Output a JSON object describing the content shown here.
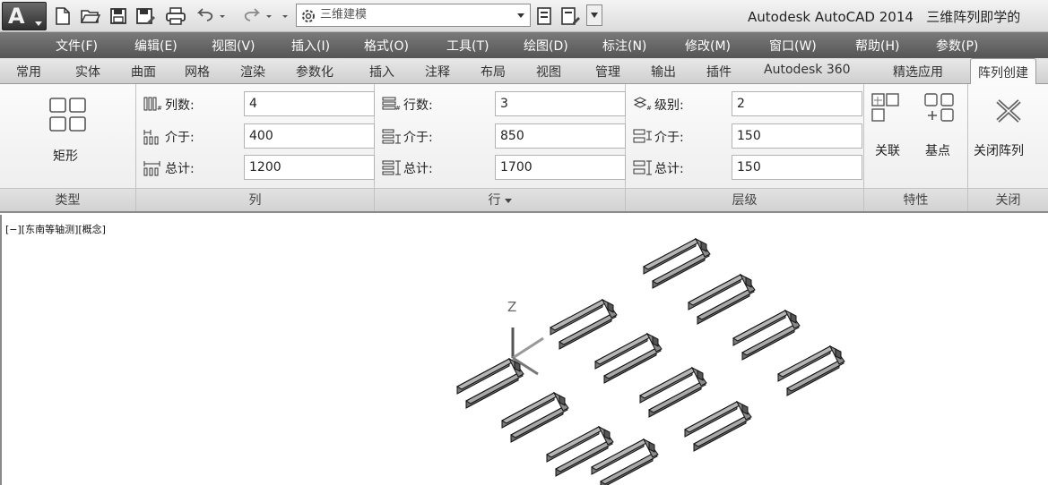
{
  "title_bar": {
    "app_name": "Autodesk AutoCAD 2014",
    "file_name": "三维阵列即学的",
    "workspace": "三维建模"
  },
  "menu": [
    "文件(F)",
    "编辑(E)",
    "视图(V)",
    "插入(I)",
    "格式(O)",
    "工具(T)",
    "绘图(D)",
    "标注(N)",
    "修改(M)",
    "窗口(W)",
    "帮助(H)",
    "参数(P)"
  ],
  "tabs": [
    "常用",
    "实体",
    "曲面",
    "网格",
    "渲染",
    "参数化",
    "插入",
    "注释",
    "布局",
    "视图",
    "管理",
    "输出",
    "插件",
    "Autodesk 360",
    "精选应用",
    "阵列创建"
  ],
  "active_tab": "阵列创建",
  "ribbon": {
    "type_panel": {
      "button": "矩形",
      "title": "类型"
    },
    "columns_panel": {
      "title": "列",
      "count_label": "列数:",
      "count_value": "4",
      "between_label": "介于:",
      "between_value": "400",
      "total_label": "总计:",
      "total_value": "1200"
    },
    "rows_panel": {
      "title": "行",
      "count_label": "行数:",
      "count_value": "3",
      "between_label": "介于:",
      "between_value": "850",
      "total_label": "总计:",
      "total_value": "1700"
    },
    "levels_panel": {
      "title": "层级",
      "count_label": "级别:",
      "count_value": "2",
      "between_label": "介于:",
      "between_value": "150",
      "total_label": "总计:",
      "total_value": "150"
    },
    "properties_panel": {
      "title": "特性",
      "associative": "关联",
      "base_point": "基点"
    },
    "close_panel": {
      "title": "关闭",
      "close_array": "关闭阵列"
    }
  },
  "viewport": {
    "label": "[−][东南等轴测][概念]",
    "axis_z": "Z"
  },
  "icons": [
    "autocad-logo-icon",
    "new-icon",
    "open-icon",
    "save-icon",
    "save-as-icon",
    "plot-icon",
    "undo-icon",
    "redo-icon",
    "gear-icon",
    "rectangular-array-icon",
    "close-array-icon"
  ]
}
